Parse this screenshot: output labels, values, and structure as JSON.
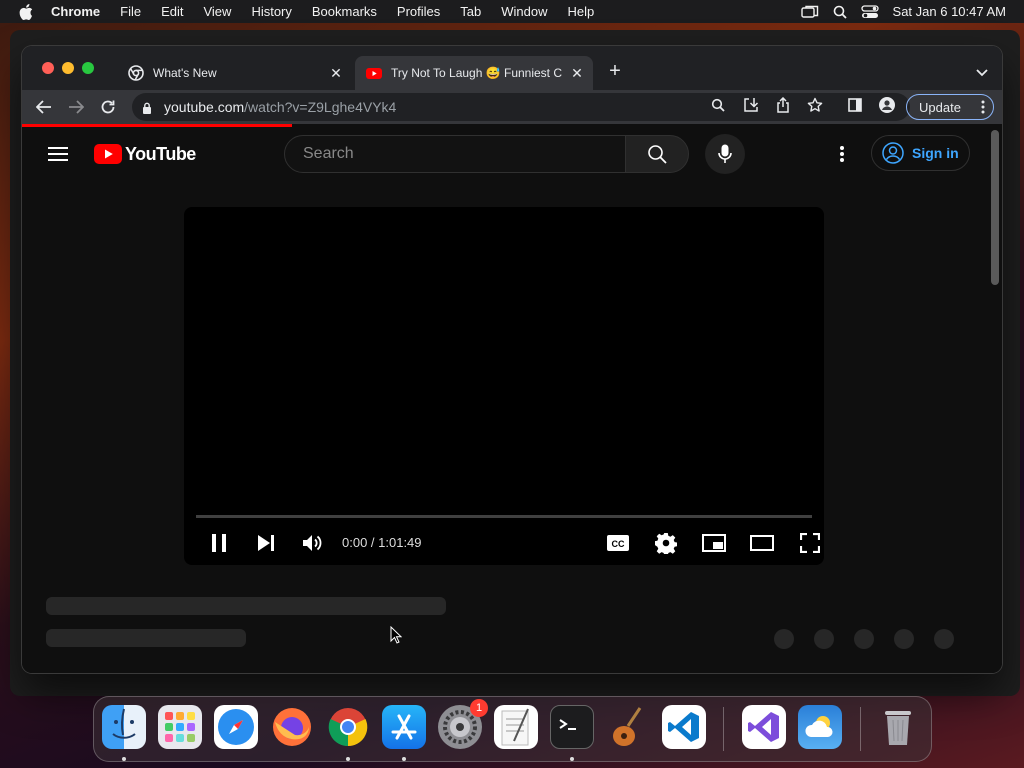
{
  "menubar": {
    "app_name": "Chrome",
    "items": [
      "File",
      "Edit",
      "View",
      "History",
      "Bookmarks",
      "Profiles",
      "Tab",
      "Window",
      "Help"
    ],
    "clock": "Sat Jan 6  10:47 AM"
  },
  "browser": {
    "tabs": [
      {
        "title": "What's New"
      },
      {
        "title": "Try Not To Laugh 😅 Funniest C"
      }
    ],
    "url": {
      "host": "youtube.com",
      "path": "/watch?v=Z9Lghe4VYk4"
    },
    "update_label": "Update"
  },
  "youtube": {
    "logo_text": "YouTube",
    "search_placeholder": "Search",
    "sign_in_label": "Sign in",
    "player": {
      "time": "0:00 / 1:01:49",
      "cc_label": "CC"
    }
  },
  "dock": {
    "apps": [
      "Finder",
      "Launchpad",
      "Safari",
      "Firefox",
      "Chrome",
      "App Store",
      "System Settings",
      "TextEdit",
      "Terminal",
      "GarageBand",
      "Visual Studio Code",
      "Visual Studio",
      "Weather",
      "Trash"
    ],
    "system_settings_badge": "1"
  }
}
